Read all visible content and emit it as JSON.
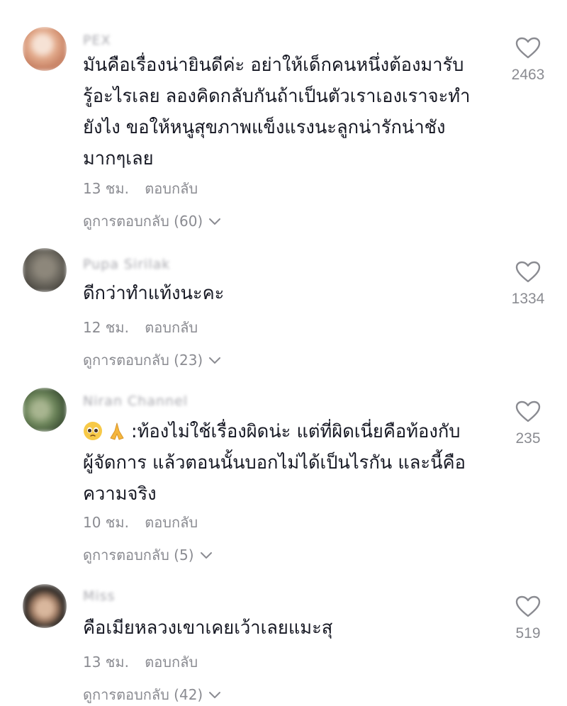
{
  "comments": [
    {
      "username": "PEX",
      "lines": [
        "มันคือเรื่องน่ายินดีค่ะ อย่าให้เด็กคนหนึ่งต้องมารับ",
        "รู้อะไรเลย ลองคิดกลับกันถ้าเป็นตัวเราเองเราจะทำ",
        "ยังไง ขอให้หนูสุขภาพแข็งแรงนะลูกน่ารักน่าชัง",
        "มากๆเลย"
      ],
      "time": "13 ชม.",
      "reply_label": "ตอบกลับ",
      "view_replies": "ดูการตอบกลับ (60)",
      "likes": "2463",
      "avatar_colors": [
        "#e8b8a0",
        "#c98a6e",
        "#f3d9c9"
      ]
    },
    {
      "username": "Pupa Sirilak",
      "lines": [
        "ดีกว่าทำแท้งนะคะ"
      ],
      "time": "12 ชม.",
      "reply_label": "ตอบกลับ",
      "view_replies": "ดูการตอบกลับ (23)",
      "likes": "1334",
      "avatar_colors": [
        "#6e6a60",
        "#9a9386",
        "#3f3d38"
      ]
    },
    {
      "username": "Niran Channel",
      "emoji_prefix": [
        "pleading-face",
        "folded-hands"
      ],
      "lines": [
        ":ท้องไม่ใช้เรื่องผิดน่ะ แต่ที่ผิดเนี่ยคือท้องกับ",
        "ผู้จัดการ แล้วตอนนั้นบอกไม่ได้เป็นไรกัน และนี้คือ",
        "ความจริง"
      ],
      "time": "10 ชม.",
      "reply_label": "ตอบกลับ",
      "view_replies": "ดูการตอบกลับ (5)",
      "likes": "235",
      "avatar_colors": [
        "#5e7a52",
        "#8fa07a",
        "#3d4a38"
      ]
    },
    {
      "username": "Miss",
      "lines": [
        "คือเมียหลวงเขาเคยเว้าเลยแมะสุ"
      ],
      "time": "13 ชม.",
      "reply_label": "ตอบกลับ",
      "view_replies": "ดูการตอบกลับ (42)",
      "likes": "519",
      "avatar_colors": [
        "#2b2622",
        "#d8b49a",
        "#5a4a40"
      ]
    }
  ],
  "colors": {
    "text_primary": "#161823",
    "text_secondary": "#8a8b91",
    "heart_stroke": "#8a8b91"
  }
}
